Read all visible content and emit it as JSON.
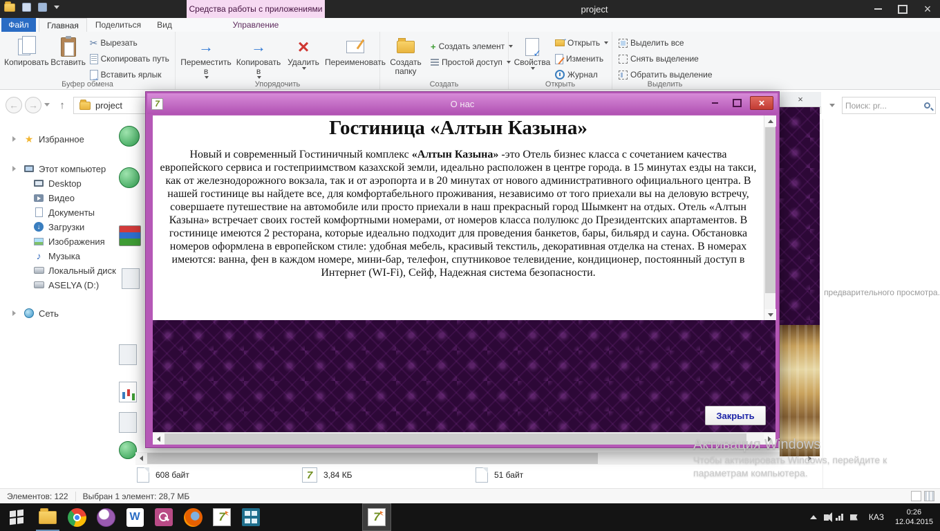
{
  "titlebar": {
    "title": "project",
    "context_tab": "Средства работы с приложениями"
  },
  "tabs": {
    "file": "Файл",
    "home": "Главная",
    "share": "Поделиться",
    "view": "Вид",
    "manage": "Управление"
  },
  "ribbon": {
    "copy": "Копировать",
    "paste": "Вставить",
    "cut": "Вырезать",
    "copy_path": "Скопировать путь",
    "paste_shortcut": "Вставить ярлык",
    "move_to": "Переместить в",
    "copy_to": "Копировать в",
    "delete": "Удалить",
    "rename": "Переименовать",
    "new_folder": "Создать папку",
    "new_item": "Создать элемент",
    "easy_access": "Простой доступ",
    "properties": "Свойства",
    "open": "Открыть",
    "edit": "Изменить",
    "history": "Журнал",
    "select_all": "Выделить все",
    "select_none": "Снять выделение",
    "invert_selection": "Обратить выделение",
    "groups": {
      "clipboard": "Буфер обмена",
      "organize": "Упорядочить",
      "new": "Создать",
      "open": "Открыть",
      "select": "Выделить"
    }
  },
  "nav": {
    "breadcrumb": "project",
    "search_value": "Поиск: pr..."
  },
  "sidebar": {
    "favorites": "Избранное",
    "computer": "Этот компьютер",
    "items": [
      "Desktop",
      "Видео",
      "Документы",
      "Загрузки",
      "Изображения",
      "Музыка",
      "Локальный диск (",
      "ASELYA (D:)"
    ],
    "network": "Сеть"
  },
  "dialog": {
    "title": "О нас",
    "heading": "Гостиница «Алтын Казына»",
    "body_lead": "Новый и современный Гостиничный комплекс ",
    "body_bold": "«Алтын Казына»",
    "body_rest": " -это Отель бизнес класса с сочетанием качества европейского сервиса и гостеприимством казахской земли, идеально расположен в центре города. в 15 минутах езды на такси, как от железнодорожного вокзала, так и от аэропорта и в 20 минутах от нового административного официального центра. В нашей гостинице вы найдете все, для комфортабельного проживания, независимо от того приехали вы на деловую встречу, совершаете путешествие на автомобиле или просто приехали в наш прекрасный город Шымкент на отдых. Отель «Алтын Казына» встречает своих гостей комфортными номерами, от номеров класса полулюкс до Президентских апартаментов. В гостинице имеются 2 ресторана, которые идеально подходит для проведения банкетов, бары, бильярд и сауна. Обстановка номеров оформлена в европейском стиле: удобная мебель, красивый текстиль, декоративная отделка на стенах. В номерах имеются: ванна, фен в каждом номере, мини-бар, телефон, спутниковое телевидение, кондиционер, постоянный доступ в Интернет (WI-Fi), Сейф, Надежная система безопасности.",
    "close": "Закрыть"
  },
  "files": {
    "f1": "608 байт",
    "f2": "3,84 КБ",
    "f3": "51 байт"
  },
  "status": {
    "count": "Элементов: 122",
    "selection": "Выбран 1 элемент: 28,7 МБ"
  },
  "preview": {
    "tail": "предварительного просмотра."
  },
  "activation": {
    "l1": "Активация Windows",
    "l2": "Чтобы активировать Windows, перейдите к",
    "l3": "параметрам компьютера."
  },
  "tray": {
    "lang": "КАЗ",
    "time": "0:26",
    "date": "12.04.2015"
  },
  "icons": {
    "search": "magnifier",
    "favorites": "gold-star",
    "delete": "red-x",
    "cut": "scissors",
    "folder": "yellow-folder",
    "dialog_app": "delphi-7",
    "start": "windows-logo"
  }
}
